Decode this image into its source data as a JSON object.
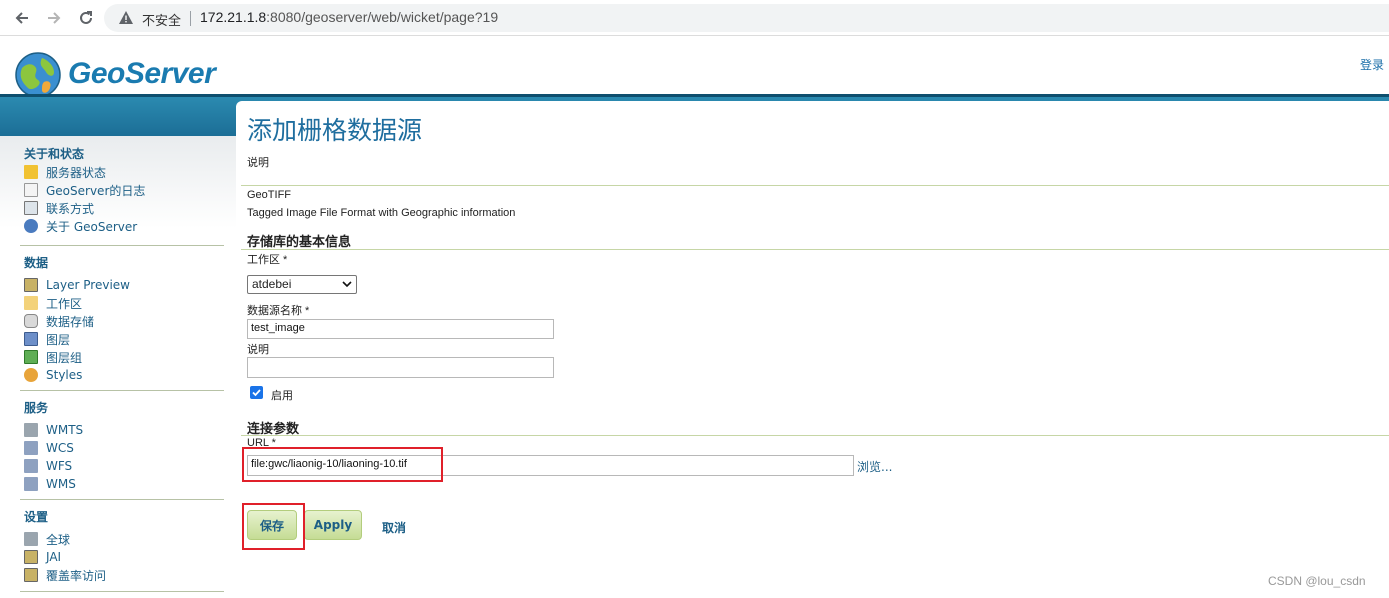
{
  "browser": {
    "insecure_label": "不安全",
    "url_host": "172.21.1.8",
    "url_rest": ":8080/geoserver/web/wicket/page?19"
  },
  "header": {
    "logo_text": "GeoServer",
    "login_link": "登录"
  },
  "sidebar": {
    "sections": [
      {
        "title": "关于和状态",
        "items": [
          "服务器状态",
          "GeoServer的日志",
          "联系方式",
          "关于 GeoServer"
        ]
      },
      {
        "title": "数据",
        "items": [
          "Layer Preview",
          "工作区",
          "数据存储",
          "图层",
          "图层组",
          "Styles"
        ]
      },
      {
        "title": "服务",
        "items": [
          "WMTS",
          "WCS",
          "WFS",
          "WMS"
        ]
      },
      {
        "title": "设置",
        "items": [
          "全球",
          "JAI",
          "覆盖率访问"
        ]
      }
    ]
  },
  "main": {
    "title": "添加栅格数据源",
    "subtitle": "说明",
    "format_name": "GeoTIFF",
    "format_desc": "Tagged Image File Format with Geographic information",
    "basic_section": "存储库的基本信息",
    "workspace_label": "工作区 *",
    "workspace_value": "atdebei",
    "name_label": "数据源名称 *",
    "name_value": "test_image",
    "desc_label": "说明",
    "desc_value": "",
    "enabled_label": "启用",
    "enabled": true,
    "conn_section": "连接参数",
    "url_label": "URL *",
    "url_value": "file:gwc/liaonig-10/liaoning-10.tif",
    "browse_label": "浏览...",
    "save_label": "保存",
    "apply_label": "Apply",
    "cancel_label": "取消"
  },
  "watermark": "CSDN @lou_csdn",
  "colors": {
    "brand_blue": "#1a7bb0",
    "band_blue": "#1c6e96",
    "link_blue": "#1d5f86",
    "highlight_red": "#e0202a",
    "button_green": "#c5dc95"
  }
}
